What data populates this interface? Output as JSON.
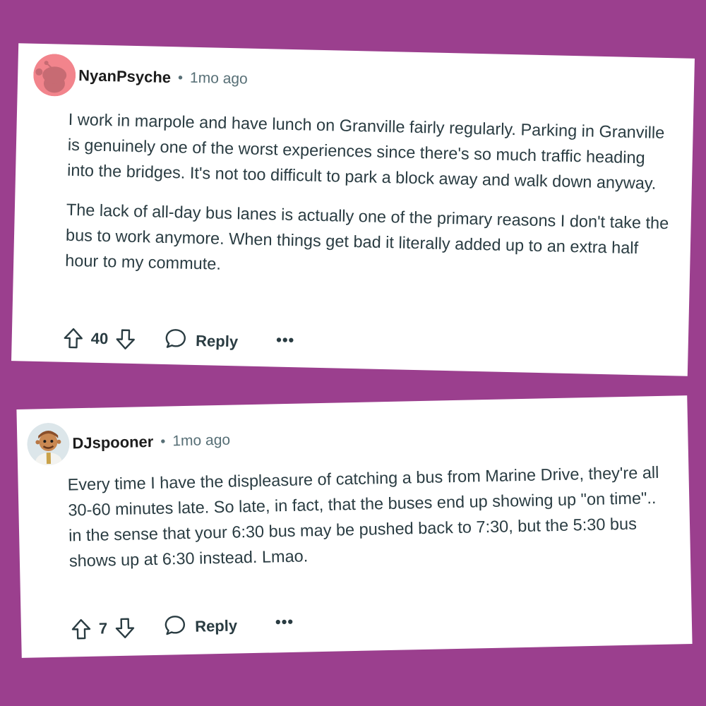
{
  "comments": [
    {
      "username": "NyanPsyche",
      "separator": "•",
      "time": "1mo ago",
      "avatar_icon": "snoo-avatar-icon",
      "avatar_bg": "#f2848c",
      "paragraphs": [
        "I work in marpole and have lunch on Granville fairly regularly. Parking in Granville is genuinely one of the worst experiences since there's so much traffic heading into the bridges. It's not too difficult to park a block away and walk down anyway.",
        "The lack of all-day bus lanes is actually one of the primary reasons I don't take the bus to work anymore. When things get bad it literally added up to an extra half hour to my commute."
      ],
      "score": "40",
      "reply_label": "Reply",
      "more_label": "•••"
    },
    {
      "username": "DJspooner",
      "separator": "•",
      "time": "1mo ago",
      "avatar_icon": "custom-avatar-icon",
      "avatar_bg": "#dce6ea",
      "paragraphs": [
        "Every time I have the displeasure of catching a bus from Marine Drive, they're all 30-60 minutes late. So late, in fact, that the buses end up showing up \"on time\".. in the sense that your 6:30 bus may be pushed back to 7:30, but the 5:30 bus shows up at 6:30 instead. Lmao."
      ],
      "score": "7",
      "reply_label": "Reply",
      "more_label": "•••"
    }
  ],
  "colors": {
    "background": "#9b3f8e",
    "card": "#ffffff",
    "meta_text": "#576f76",
    "body_text": "#2a3c42"
  }
}
